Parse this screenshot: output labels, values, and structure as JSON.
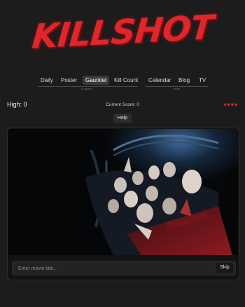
{
  "logo": {
    "text": "KILLSHOT"
  },
  "nav": {
    "items": [
      {
        "label": "Daily"
      },
      {
        "label": "Poster"
      },
      {
        "label": "Gauntlet",
        "active": true
      },
      {
        "label": "Kill Count"
      },
      {
        "label": "Calendar"
      },
      {
        "label": "Blog"
      },
      {
        "label": "TV"
      }
    ],
    "games_label": "D games",
    "other_label": "other"
  },
  "stats": {
    "high_score": "High: 0",
    "current_score": "Current Score: 0",
    "hearts": "♥♥♥♥",
    "lives": 4
  },
  "help_label": "Help",
  "guess": {
    "placeholder": "Enter movie title...",
    "skip_label": "Skip"
  },
  "colors": {
    "brand_red": "#e0262b",
    "background": "#1c1c1c",
    "card": "#121212"
  }
}
